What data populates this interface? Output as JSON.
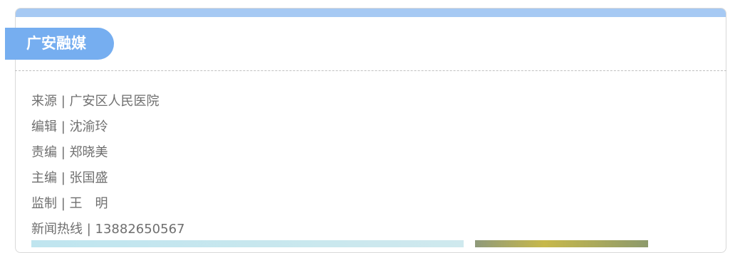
{
  "brand": {
    "name": "广安融媒"
  },
  "credits": [
    {
      "role": "来源",
      "separator": " | ",
      "value": "广安区人民医院"
    },
    {
      "role": "编辑",
      "separator": " | ",
      "value": "沈渝玲"
    },
    {
      "role": "责编",
      "separator": " | ",
      "value": "郑晓美"
    },
    {
      "role": "主编",
      "separator": " | ",
      "value": "张国盛"
    },
    {
      "role": "监制",
      "separator": " | ",
      "value": "王　明"
    },
    {
      "role": "新闻热线",
      "separator": " | ",
      "value": "13882650567"
    }
  ],
  "colors": {
    "top_bar": "#a6c9f3",
    "brand_tag": "#76aef0",
    "text": "#6f6f6f"
  }
}
